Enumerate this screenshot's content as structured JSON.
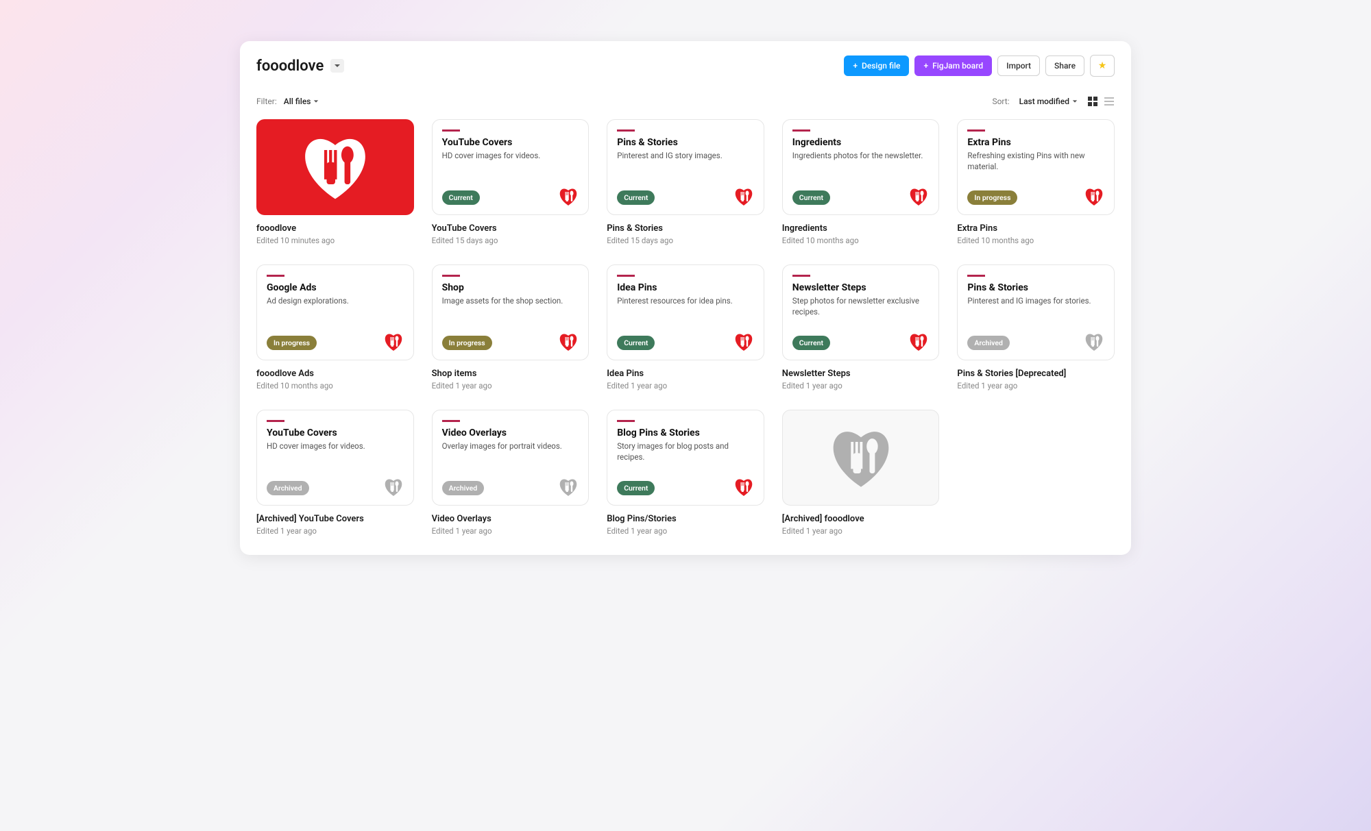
{
  "header": {
    "project_title": "fooodlove",
    "design_file_label": "Design file",
    "figjam_label": "FigJam board",
    "import_label": "Import",
    "share_label": "Share"
  },
  "filter": {
    "filter_label": "Filter:",
    "filter_value": "All files",
    "sort_label": "Sort:",
    "sort_value": "Last modified"
  },
  "files": [
    {
      "kind": "cover_red",
      "name": "fooodlove",
      "meta": "Edited 10 minutes ago"
    },
    {
      "kind": "card",
      "card_title": "YouTube Covers",
      "card_sub": "HD cover images for videos.",
      "tag": "Current",
      "tag_style": "current",
      "heart": "red",
      "name": "YouTube Covers",
      "meta": "Edited 15 days ago"
    },
    {
      "kind": "card",
      "card_title": "Pins & Stories",
      "card_sub": "Pinterest and IG story images.",
      "tag": "Current",
      "tag_style": "current",
      "heart": "red",
      "name": "Pins & Stories",
      "meta": "Edited 15 days ago"
    },
    {
      "kind": "card",
      "card_title": "Ingredients",
      "card_sub": "Ingredients photos for the newsletter.",
      "tag": "Current",
      "tag_style": "current",
      "heart": "red",
      "name": "Ingredients",
      "meta": "Edited 10 months ago"
    },
    {
      "kind": "card",
      "card_title": "Extra Pins",
      "card_sub": "Refreshing existing Pins with new material.",
      "tag": "In progress",
      "tag_style": "progress",
      "heart": "red",
      "name": "Extra Pins",
      "meta": "Edited 10 months ago"
    },
    {
      "kind": "card",
      "card_title": "Google Ads",
      "card_sub": "Ad design explorations.",
      "tag": "In progress",
      "tag_style": "progress",
      "heart": "red",
      "name": "fooodlove Ads",
      "meta": "Edited 10 months ago"
    },
    {
      "kind": "card",
      "card_title": "Shop",
      "card_sub": "Image assets for the shop section.",
      "tag": "In progress",
      "tag_style": "progress",
      "heart": "red",
      "name": "Shop items",
      "meta": "Edited 1 year ago"
    },
    {
      "kind": "card",
      "card_title": "Idea Pins",
      "card_sub": "Pinterest resources for idea pins.",
      "tag": "Current",
      "tag_style": "current",
      "heart": "red",
      "name": "Idea Pins",
      "meta": "Edited 1 year ago"
    },
    {
      "kind": "card",
      "card_title": "Newsletter Steps",
      "card_sub": "Step photos for newsletter exclusive recipes.",
      "tag": "Current",
      "tag_style": "current",
      "heart": "red",
      "name": "Newsletter Steps",
      "meta": "Edited 1 year ago"
    },
    {
      "kind": "card",
      "card_title": "Pins & Stories",
      "card_sub": "Pinterest and IG images for stories.",
      "tag": "Archived",
      "tag_style": "archived",
      "heart": "gray",
      "name": "Pins & Stories [Deprecated]",
      "meta": "Edited 1 year ago"
    },
    {
      "kind": "card",
      "card_title": "YouTube Covers",
      "card_sub": "HD cover images for videos.",
      "tag": "Archived",
      "tag_style": "archived",
      "heart": "gray",
      "name": "[Archived] YouTube Covers",
      "meta": "Edited 1 year ago"
    },
    {
      "kind": "card",
      "card_title": "Video Overlays",
      "card_sub": "Overlay images for portrait videos.",
      "tag": "Archived",
      "tag_style": "archived",
      "heart": "gray",
      "name": "Video Overlays",
      "meta": "Edited 1 year ago"
    },
    {
      "kind": "card",
      "card_title": "Blog Pins & Stories",
      "card_sub": "Story images for blog posts and recipes.",
      "tag": "Current",
      "tag_style": "current",
      "heart": "red",
      "name": "Blog Pins/Stories",
      "meta": "Edited 1 year ago"
    },
    {
      "kind": "cover_gray",
      "name": "[Archived] fooodlove",
      "meta": "Edited 1 year ago"
    }
  ]
}
